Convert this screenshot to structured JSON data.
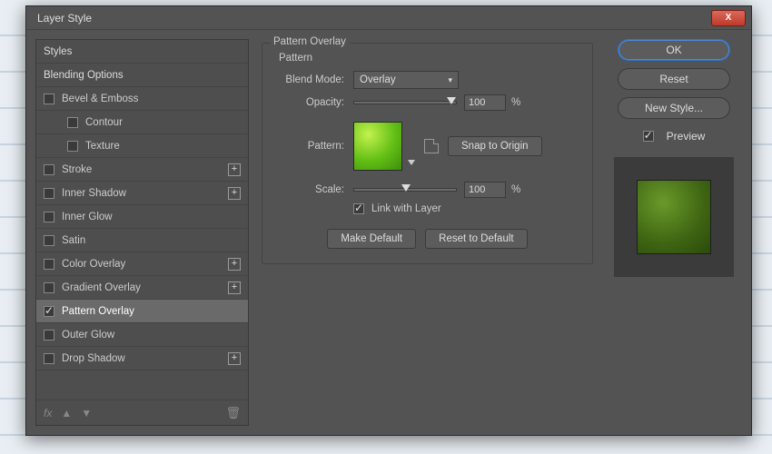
{
  "dialog": {
    "title": "Layer Style"
  },
  "close": "X",
  "left": {
    "styles": "Styles",
    "blending": "Blending Options",
    "effects": [
      {
        "label": "Bevel & Emboss",
        "checked": false,
        "plus": false,
        "sub": false
      },
      {
        "label": "Contour",
        "checked": false,
        "plus": false,
        "sub": true
      },
      {
        "label": "Texture",
        "checked": false,
        "plus": false,
        "sub": true
      },
      {
        "label": "Stroke",
        "checked": false,
        "plus": true,
        "sub": false
      },
      {
        "label": "Inner Shadow",
        "checked": false,
        "plus": true,
        "sub": false
      },
      {
        "label": "Inner Glow",
        "checked": false,
        "plus": false,
        "sub": false
      },
      {
        "label": "Satin",
        "checked": false,
        "plus": false,
        "sub": false
      },
      {
        "label": "Color Overlay",
        "checked": false,
        "plus": true,
        "sub": false
      },
      {
        "label": "Gradient Overlay",
        "checked": false,
        "plus": true,
        "sub": false
      },
      {
        "label": "Pattern Overlay",
        "checked": true,
        "plus": false,
        "sub": false,
        "selected": true
      },
      {
        "label": "Outer Glow",
        "checked": false,
        "plus": false,
        "sub": false
      },
      {
        "label": "Drop Shadow",
        "checked": false,
        "plus": true,
        "sub": false
      }
    ],
    "fx_label": "fx"
  },
  "center": {
    "group_title": "Pattern Overlay",
    "sub_title": "Pattern",
    "blend_mode_label": "Blend Mode:",
    "blend_mode_value": "Overlay",
    "opacity_label": "Opacity:",
    "opacity_value": "100",
    "percent": "%",
    "pattern_label": "Pattern:",
    "snap_label": "Snap to Origin",
    "scale_label": "Scale:",
    "scale_value": "100",
    "link_label": "Link with Layer",
    "make_default": "Make Default",
    "reset_default": "Reset to Default"
  },
  "right": {
    "ok": "OK",
    "reset": "Reset",
    "new_style": "New Style...",
    "preview": "Preview"
  }
}
